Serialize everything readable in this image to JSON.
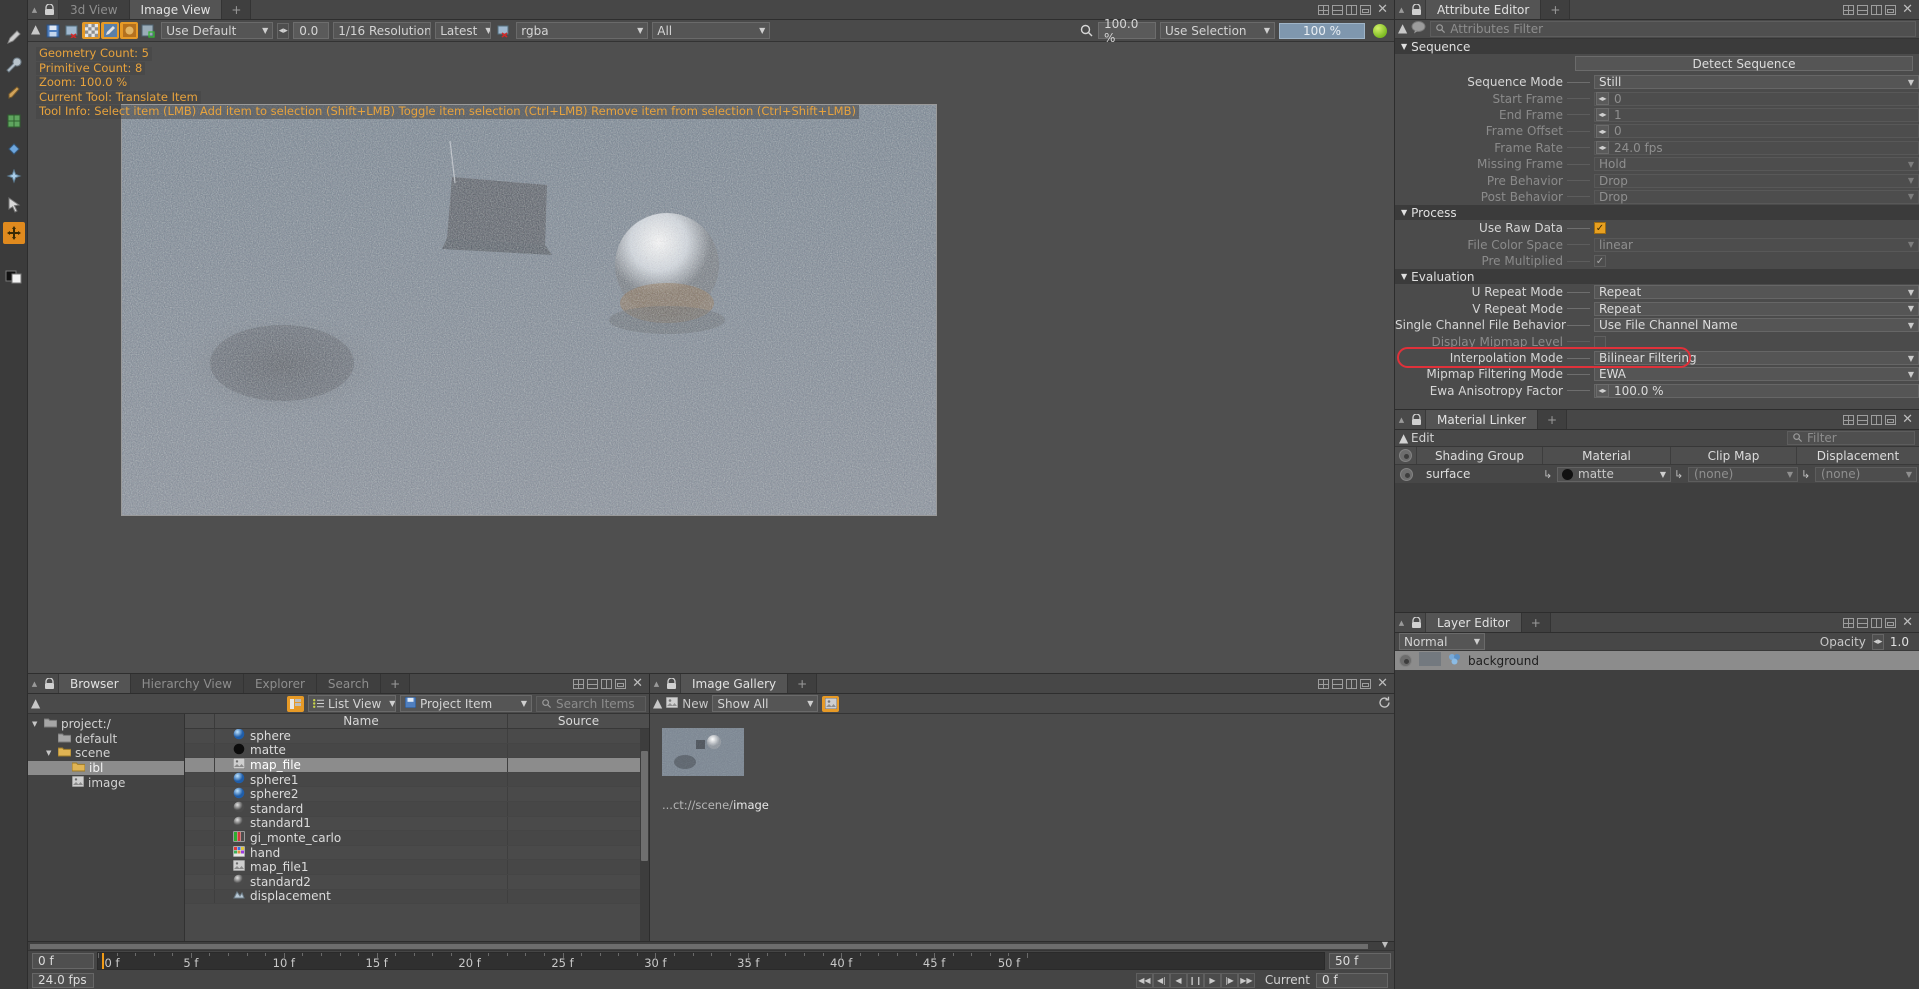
{
  "image_view": {
    "tabs": [
      {
        "label": "3d View",
        "active": false
      },
      {
        "label": "Image View",
        "active": true
      },
      {
        "label": "+",
        "active": false
      }
    ],
    "toolbar": {
      "display_mode": "Use Default",
      "exposure": "0.0",
      "resolution": "1/16 Resolution",
      "version": "Latest",
      "channel": "rgba",
      "layer": "All",
      "zoom_value": "100.0 %",
      "selection_mode": "Use Selection",
      "progress": "100 %"
    },
    "overlay": {
      "geometry_count": "Geometry Count: 5",
      "primitive_count": "Primitive Count: 8",
      "zoom": "Zoom: 100.0 %",
      "current_tool": "Current Tool: Translate Item",
      "tool_info": "Tool Info: Select item (LMB)  Add item to selection (Shift+LMB)  Toggle item selection (Ctrl+LMB)  Remove item from selection (Ctrl+Shift+LMB)"
    }
  },
  "attribute_editor": {
    "title": "Attribute Editor",
    "plus": "+",
    "filter_placeholder": "Attributes Filter",
    "detect_sequence": "Detect Sequence",
    "sections": [
      {
        "name": "Sequence",
        "rows": [
          {
            "label": "Sequence Mode",
            "value": "Still",
            "type": "dropdown",
            "dim": false
          },
          {
            "label": "Start Frame",
            "value": "0",
            "type": "spin",
            "dim": true
          },
          {
            "label": "End Frame",
            "value": "1",
            "type": "spin",
            "dim": true
          },
          {
            "label": "Frame Offset",
            "value": "0",
            "type": "spin",
            "dim": true
          },
          {
            "label": "Frame Rate",
            "value": "24.0 fps",
            "type": "spin",
            "dim": true
          },
          {
            "label": "Missing Frame",
            "value": "Hold",
            "type": "dropdown",
            "dim": true
          },
          {
            "label": "Pre Behavior",
            "value": "Drop",
            "type": "dropdown",
            "dim": true
          },
          {
            "label": "Post Behavior",
            "value": "Drop",
            "type": "dropdown",
            "dim": true
          }
        ]
      },
      {
        "name": "Process",
        "rows": [
          {
            "label": "Use Raw Data",
            "value": "",
            "type": "checkbox-on",
            "dim": false
          },
          {
            "label": "File Color Space",
            "value": "linear",
            "type": "dropdown",
            "dim": true
          },
          {
            "label": "Pre Multiplied",
            "value": "",
            "type": "checkbox-grey",
            "dim": true
          }
        ]
      },
      {
        "name": "Evaluation",
        "rows": [
          {
            "label": "U Repeat Mode",
            "value": "Repeat",
            "type": "dropdown",
            "dim": false
          },
          {
            "label": "V Repeat Mode",
            "value": "Repeat",
            "type": "dropdown",
            "dim": false
          },
          {
            "label": "Single Channel File Behavior",
            "value": "Use File Channel Name",
            "type": "dropdown",
            "dim": false
          },
          {
            "label": "Display Mipmap Level",
            "value": "",
            "type": "checkbox-empty",
            "dim": true
          },
          {
            "label": "Interpolation Mode",
            "value": "Bilinear Filtering",
            "type": "dropdown",
            "dim": false,
            "highlight": true
          },
          {
            "label": "Mipmap Filtering Mode",
            "value": "EWA",
            "type": "dropdown",
            "dim": false
          },
          {
            "label": "Ewa Anisotropy Factor",
            "value": "100.0 %",
            "type": "spin",
            "dim": false
          }
        ]
      }
    ]
  },
  "material_linker": {
    "title": "Material Linker",
    "plus": "+",
    "edit_label": "Edit",
    "filter_placeholder": "Filter",
    "columns": [
      "Shading Group",
      "Material",
      "Clip Map",
      "Displacement"
    ],
    "rows": [
      {
        "shading_group": "surface",
        "material": "matte",
        "clip_map": "(none)",
        "displacement": "(none)"
      }
    ]
  },
  "layer_editor": {
    "title": "Layer Editor",
    "plus": "+",
    "blend_mode": "Normal",
    "opacity_label": "Opacity",
    "opacity_value": "1.0",
    "layers": [
      {
        "name": "background"
      }
    ]
  },
  "browser": {
    "tabs": [
      {
        "label": "Browser",
        "active": true
      },
      {
        "label": "Hierarchy View",
        "active": false
      },
      {
        "label": "Explorer",
        "active": false
      },
      {
        "label": "Search",
        "active": false
      },
      {
        "label": "+",
        "active": false
      }
    ],
    "view_mode": "List View",
    "item_filter": "Project Item",
    "search_placeholder": "Search Items",
    "tree": [
      {
        "label": "project:/",
        "depth": 0,
        "twisty": "▼",
        "icon": "folder-grey",
        "selected": false
      },
      {
        "label": "default",
        "depth": 1,
        "twisty": "",
        "icon": "folder-grey",
        "selected": false
      },
      {
        "label": "scene",
        "depth": 1,
        "twisty": "▼",
        "icon": "folder-yellow",
        "selected": false
      },
      {
        "label": "ibl",
        "depth": 2,
        "twisty": "",
        "icon": "folder-yellow",
        "selected": true
      },
      {
        "label": "image",
        "depth": 2,
        "twisty": "",
        "icon": "image",
        "selected": false
      }
    ],
    "columns": [
      "Name",
      "Source"
    ],
    "items": [
      {
        "name": "sphere",
        "icon": "sphere-blue",
        "source": "",
        "selected": false
      },
      {
        "name": "matte",
        "icon": "sphere-black",
        "source": "",
        "selected": false
      },
      {
        "name": "map_file",
        "icon": "image",
        "source": "",
        "selected": true
      },
      {
        "name": "sphere1",
        "icon": "sphere-blue",
        "source": "",
        "selected": false
      },
      {
        "name": "sphere2",
        "icon": "sphere-blue",
        "source": "",
        "selected": false
      },
      {
        "name": "standard",
        "icon": "sphere-grey",
        "source": "",
        "selected": false
      },
      {
        "name": "standard1",
        "icon": "sphere-grey",
        "source": "",
        "selected": false
      },
      {
        "name": "gi_monte_carlo",
        "icon": "gi",
        "source": "",
        "selected": false
      },
      {
        "name": "hand",
        "icon": "hand",
        "source": "",
        "selected": false
      },
      {
        "name": "map_file1",
        "icon": "image",
        "source": "",
        "selected": false
      },
      {
        "name": "standard2",
        "icon": "sphere-grey",
        "source": "",
        "selected": false
      },
      {
        "name": "displacement",
        "icon": "disp",
        "source": "",
        "selected": false
      }
    ]
  },
  "image_gallery": {
    "title": "Image Gallery",
    "plus": "+",
    "new_label": "New",
    "show_filter": "Show All",
    "caption_prefix": "...ct://scene/",
    "caption_name": "image"
  },
  "timeline": {
    "start_field": "0 f",
    "fps": "24.0 fps",
    "end_field": "50 f",
    "range_end_label": "50 f",
    "current_label": "Current",
    "current_value": "0 f",
    "ticks": [
      "0 f",
      "5 f",
      "10 f",
      "15 f",
      "20 f",
      "25 f",
      "30 f",
      "35 f",
      "40 f",
      "45 f"
    ],
    "playhead_frame": 0
  },
  "colors": {
    "accent_orange": "#e8a020",
    "overlay_text": "#e8a33d",
    "highlight_red": "#e0313a",
    "selection_grey": "#8c8c8c",
    "render_green": "#8cc63e"
  }
}
